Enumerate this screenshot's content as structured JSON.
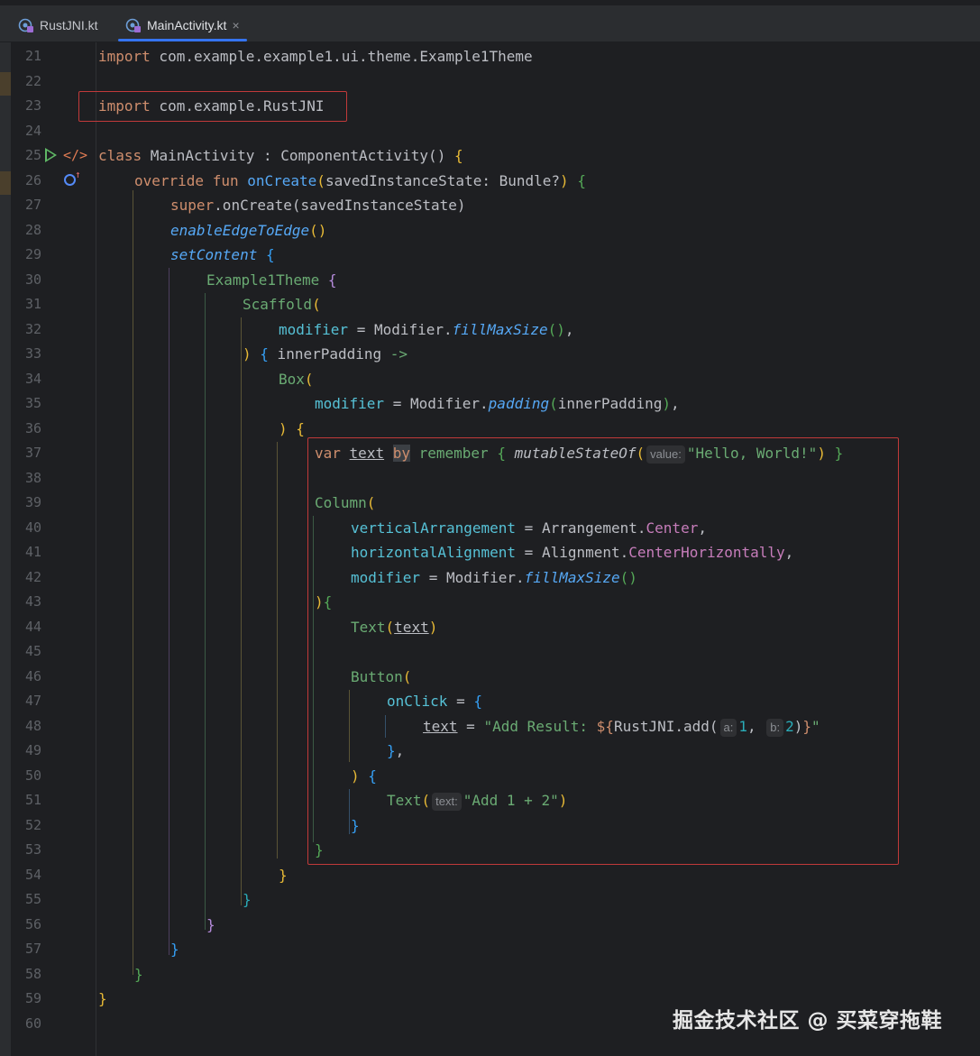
{
  "tabs": [
    {
      "label": "RustJNI.kt",
      "active": false
    },
    {
      "label": "MainActivity.kt",
      "active": true,
      "close": "×"
    }
  ],
  "line_numbers": [
    "21",
    "22",
    "23",
    "24",
    "25",
    "26",
    "27",
    "28",
    "29",
    "30",
    "31",
    "32",
    "33",
    "34",
    "35",
    "36",
    "37",
    "38",
    "39",
    "40",
    "41",
    "42",
    "43",
    "44",
    "45",
    "46",
    "47",
    "48",
    "49",
    "50",
    "51",
    "52",
    "53",
    "54",
    "55",
    "56",
    "57",
    "58",
    "59",
    "60"
  ],
  "code": {
    "import_theme": "import",
    "import_theme_path": " com.example.example1.ui.theme.Example1Theme",
    "import_rust": "import",
    "import_rust_path": " com.example.RustJNI",
    "class_kw": "class",
    "class_decl": " MainActivity : ComponentActivity() ",
    "override_kw": "override fun",
    "oncreate": "onCreate",
    "oncreate_params": "savedInstanceState: Bundle?",
    "super_kw": "super",
    "super_call": ".onCreate(savedInstanceState)",
    "edge": "enableEdgeToEdge",
    "set_content": "setContent",
    "theme": "Example1Theme",
    "scaffold": "Scaffold",
    "modifier": "modifier",
    "modifier_obj": "Modifier.",
    "fill_max_size": "fillMaxSize",
    "inner_padding": " innerPadding ",
    "arrow": "->",
    "box": "Box",
    "padding_fn": "padding",
    "inner_padding_arg": "innerPadding",
    "var_kw": "var",
    "text_var": "text",
    "by_kw": "by",
    "remember": "remember",
    "mutable": "mutableStateOf",
    "hint_value": "value:",
    "hello": "\"Hello, World!\"",
    "column": "Column",
    "vert_arr": "verticalArrangement",
    "arrangement": "Arrangement.",
    "center": "Center",
    "horiz_align": "horizontalAlignment",
    "alignment": "Alignment.",
    "center_h": "CenterHorizontally",
    "text_fn": "Text",
    "button": "Button",
    "onclick": "onClick",
    "add_result_str": "\"Add Result: ",
    "rust_add": "RustJNI.add(",
    "hint_a": "a:",
    "arg_1": "1",
    "hint_b": "b:",
    "arg_2": "2",
    "hint_text": "text:",
    "add_label": "\"Add 1 + 2\""
  },
  "watermark": "掘金技术社区 @ 买菜穿拖鞋",
  "colors": {
    "background": "#1e1f22",
    "highlight_box": "#c13a3a",
    "active_tab_underline": "#3574f0"
  }
}
